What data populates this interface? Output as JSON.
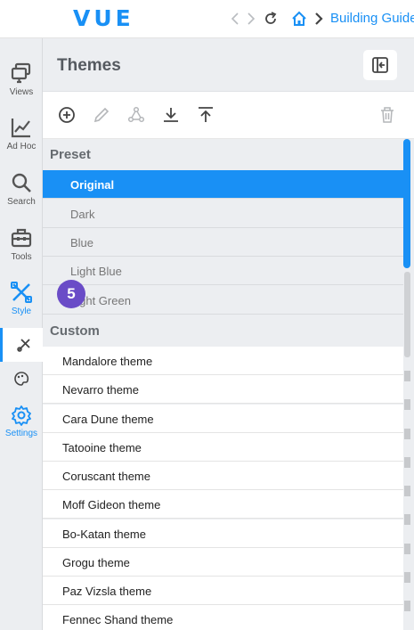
{
  "topbar": {
    "logo": "VUE",
    "breadcrumb": "Building Guide"
  },
  "rail": {
    "items": [
      {
        "label": "Views",
        "icon": "views-icon"
      },
      {
        "label": "Ad Hoc",
        "icon": "chart-line-icon"
      },
      {
        "label": "Search",
        "icon": "search-icon"
      },
      {
        "label": "Tools",
        "icon": "toolbox-icon"
      },
      {
        "label": "Style",
        "icon": "style-tools-icon"
      },
      {
        "label": "Settings",
        "icon": "gear-icon"
      }
    ]
  },
  "panel": {
    "title": "Themes"
  },
  "toolbar": {
    "icons": [
      "add-icon",
      "edit-icon",
      "share-icon",
      "download-icon",
      "upload-icon",
      "delete-icon"
    ]
  },
  "themes": {
    "preset_label": "Preset",
    "preset": [
      "Original",
      "Dark",
      "Blue",
      "Light Blue",
      "Light Green"
    ],
    "custom_label": "Custom",
    "custom": [
      "Mandalore theme",
      "Nevarro theme",
      "Cara Dune theme",
      "Tatooine theme",
      "Coruscant theme",
      "Moff Gideon theme",
      "Bo-Katan theme",
      "Grogu theme",
      "Paz Vizsla theme",
      "Fennec Shand theme"
    ]
  },
  "step_badge": "5",
  "colors": {
    "accent": "#1990f5",
    "badge": "#6a4cc7"
  }
}
